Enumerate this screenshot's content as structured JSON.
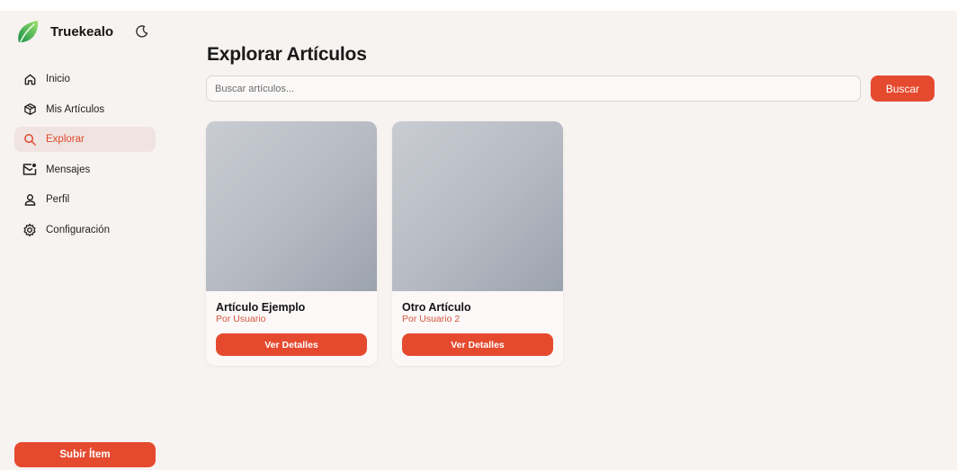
{
  "brand": {
    "name": "Truekealo"
  },
  "sidebar": {
    "items": [
      {
        "label": "Inicio",
        "icon": "home-icon"
      },
      {
        "label": "Mis Artículos",
        "icon": "package-icon"
      },
      {
        "label": "Explorar",
        "icon": "search-icon",
        "active": true
      },
      {
        "label": "Mensajes",
        "icon": "mail-icon"
      },
      {
        "label": "Perfil",
        "icon": "user-icon"
      },
      {
        "label": "Configuración",
        "icon": "gear-icon"
      }
    ],
    "upload_label": "Subir Ítem"
  },
  "main": {
    "title": "Explorar Artículos",
    "search": {
      "placeholder": "Buscar artículos...",
      "value": "",
      "button_label": "Buscar"
    },
    "items": [
      {
        "title": "Artículo Ejemplo",
        "owner": "Por Usuario",
        "button_label": "Ver Detalles"
      },
      {
        "title": "Otro Artículo",
        "owner": "Por Usuario 2",
        "button_label": "Ver Detalles"
      }
    ]
  },
  "colors": {
    "accent": "#e54a2f",
    "background": "#f7f3f1",
    "active_bg": "#efe4e1"
  }
}
